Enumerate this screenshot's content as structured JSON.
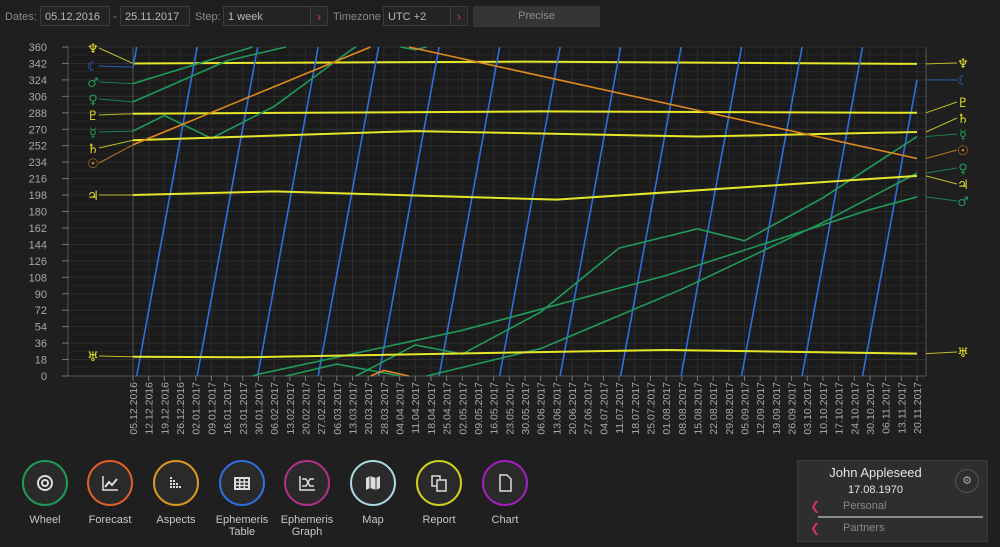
{
  "toolbar": {
    "dates_label": "Dates:",
    "date_from": "05.12.2016",
    "date_sep": "-",
    "date_to": "25.11.2017",
    "step_label": "Step:",
    "step_value": "1 week",
    "timezone_label": "Timezone",
    "timezone_value": "UTC +2",
    "precise_label": "Precise"
  },
  "dock": [
    {
      "label": "Wheel",
      "icon": "wheel-icon",
      "color": "#1f9a5a"
    },
    {
      "label": "Forecast",
      "icon": "forecast-icon",
      "color": "#e0602a"
    },
    {
      "label": "Aspects",
      "icon": "aspects-icon",
      "color": "#d89a20"
    },
    {
      "label": "Ephemeris Table",
      "icon": "table-icon",
      "color": "#2e6fe0"
    },
    {
      "label": "Ephemeris Graph",
      "icon": "graph-icon",
      "color": "#b0308a"
    },
    {
      "label": "Map",
      "icon": "map-icon",
      "color": "#a8d8e0"
    },
    {
      "label": "Report",
      "icon": "report-icon",
      "color": "#d0d020"
    },
    {
      "label": "Chart",
      "icon": "chart-icon",
      "color": "#a020c0"
    }
  ],
  "profile": {
    "name": "John Appleseed",
    "birth_date": "17.08.1970",
    "personal_label": "Personal",
    "partners_label": "Partners"
  },
  "chart_data": {
    "type": "line",
    "ylim": [
      0,
      360
    ],
    "yticks": [
      0,
      18,
      36,
      54,
      72,
      90,
      108,
      126,
      144,
      162,
      180,
      198,
      216,
      234,
      252,
      270,
      288,
      306,
      324,
      342,
      360
    ],
    "x_tick_labels": [
      "05.12.2016",
      "12.12.2016",
      "19.12.2016",
      "26.12.2016",
      "02.01.2017",
      "09.01.2017",
      "16.01.2017",
      "23.01.2017",
      "30.01.2017",
      "06.02.2017",
      "13.02.2017",
      "20.02.2017",
      "27.02.2017",
      "06.03.2017",
      "13.03.2017",
      "20.03.2017",
      "28.03.2017",
      "04.04.2017",
      "11.04.2017",
      "18.04.2017",
      "25.04.2017",
      "02.05.2017",
      "09.05.2017",
      "16.05.2017",
      "23.05.2017",
      "30.05.2017",
      "06.06.2017",
      "13.06.2017",
      "20.06.2017",
      "27.06.2017",
      "04.07.2017",
      "11.07.2017",
      "18.07.2017",
      "25.07.2017",
      "01.08.2017",
      "08.08.2017",
      "15.08.2017",
      "22.08.2017",
      "29.08.2017",
      "05.09.2017",
      "12.09.2017",
      "19.09.2017",
      "26.09.2017",
      "03.10.2017",
      "10.10.2017",
      "17.10.2017",
      "24.10.2017",
      "30.10.2017",
      "06.11.2017",
      "13.11.2017",
      "20.11.2017"
    ],
    "grid": true,
    "series": [
      {
        "name": "Neptune",
        "glyph": "♆",
        "color": "#e6e62a",
        "points": [
          [
            "05.12.2016",
            342
          ],
          [
            "29.05.2017",
            344
          ],
          [
            "20.11.2017",
            341.5
          ]
        ]
      },
      {
        "name": "Moon",
        "glyph": "☾",
        "color": "#2e6fe0",
        "weekly": [
          338,
          71.3,
          164.6,
          258,
          351.3,
          84.6,
          177.9,
          271.2,
          4.6,
          97.9,
          191.2,
          284.5,
          17.8,
          111.2,
          204.5,
          297.8,
          31.1,
          124.4,
          217.8,
          311.1,
          44.4,
          137.7,
          231,
          324.4,
          57.7,
          151,
          244.3,
          337.6,
          71,
          164.3,
          257.6,
          350.9,
          84.2,
          177.6,
          270.9,
          4.2,
          97.5,
          190.9,
          284.2,
          17.5,
          110.8,
          204.1,
          297.5,
          30.8,
          124.1,
          217.4,
          310.8,
          44.1,
          137.4,
          230.7,
          324
        ]
      },
      {
        "name": "Mars",
        "glyph": "♂",
        "color": "#1f9a5a",
        "points": [
          [
            "05.12.2016",
            320
          ],
          [
            "30.01.2017",
            362
          ],
          [
            "01.05.2017",
            50
          ],
          [
            "31.07.2017",
            110
          ],
          [
            "30.10.2017",
            182
          ],
          [
            "20.11.2017",
            196
          ]
        ]
      },
      {
        "name": "Venus",
        "glyph": "♀",
        "color": "#1f9a5a",
        "points": [
          [
            "05.12.2016",
            300
          ],
          [
            "16.01.2017",
            345
          ],
          [
            "06.03.2017",
            373
          ],
          [
            "10.04.2017",
            357
          ],
          [
            "05.06.2017",
            30
          ],
          [
            "07.08.2017",
            95
          ],
          [
            "09.10.2017",
            168
          ],
          [
            "20.11.2017",
            222
          ]
        ]
      },
      {
        "name": "Pluto",
        "glyph": "♇",
        "color": "#e6e62a",
        "points": [
          [
            "05.12.2016",
            287
          ],
          [
            "05.06.2017",
            289.5
          ],
          [
            "20.11.2017",
            288
          ]
        ]
      },
      {
        "name": "Mercury",
        "glyph": "☿",
        "color": "#1f9a5a",
        "points": [
          [
            "05.12.2016",
            268
          ],
          [
            "19.12.2016",
            285
          ],
          [
            "09.01.2017",
            260
          ],
          [
            "06.02.2017",
            295
          ],
          [
            "13.03.2017",
            358
          ],
          [
            "10.04.2017",
            34
          ],
          [
            "01.05.2017",
            24
          ],
          [
            "05.06.2017",
            70
          ],
          [
            "10.07.2017",
            140
          ],
          [
            "14.08.2017",
            161
          ],
          [
            "04.09.2017",
            148
          ],
          [
            "09.10.2017",
            195
          ],
          [
            "20.11.2017",
            262
          ]
        ]
      },
      {
        "name": "Saturn",
        "glyph": "♄",
        "color": "#e6e62a",
        "points": [
          [
            "05.12.2016",
            258
          ],
          [
            "10.04.2017",
            268
          ],
          [
            "14.08.2017",
            262
          ],
          [
            "20.11.2017",
            267
          ]
        ]
      },
      {
        "name": "Sun",
        "glyph": "☉",
        "color": "#e08a1e",
        "points": [
          [
            "05.12.2016",
            253
          ],
          [
            "27.03.2017",
            366
          ],
          [
            "20.11.2017",
            238
          ]
        ]
      },
      {
        "name": "Jupiter",
        "glyph": "♃",
        "color": "#e6e62a",
        "points": [
          [
            "05.12.2016",
            198
          ],
          [
            "06.02.2017",
            202
          ],
          [
            "12.06.2017",
            193
          ],
          [
            "20.11.2017",
            219
          ]
        ]
      },
      {
        "name": "Uranus",
        "glyph": "♅",
        "color": "#e6e62a",
        "points": [
          [
            "05.12.2016",
            21
          ],
          [
            "23.01.2017",
            20.5
          ],
          [
            "31.07.2017",
            28.5
          ],
          [
            "20.11.2017",
            24.5
          ]
        ]
      }
    ]
  }
}
